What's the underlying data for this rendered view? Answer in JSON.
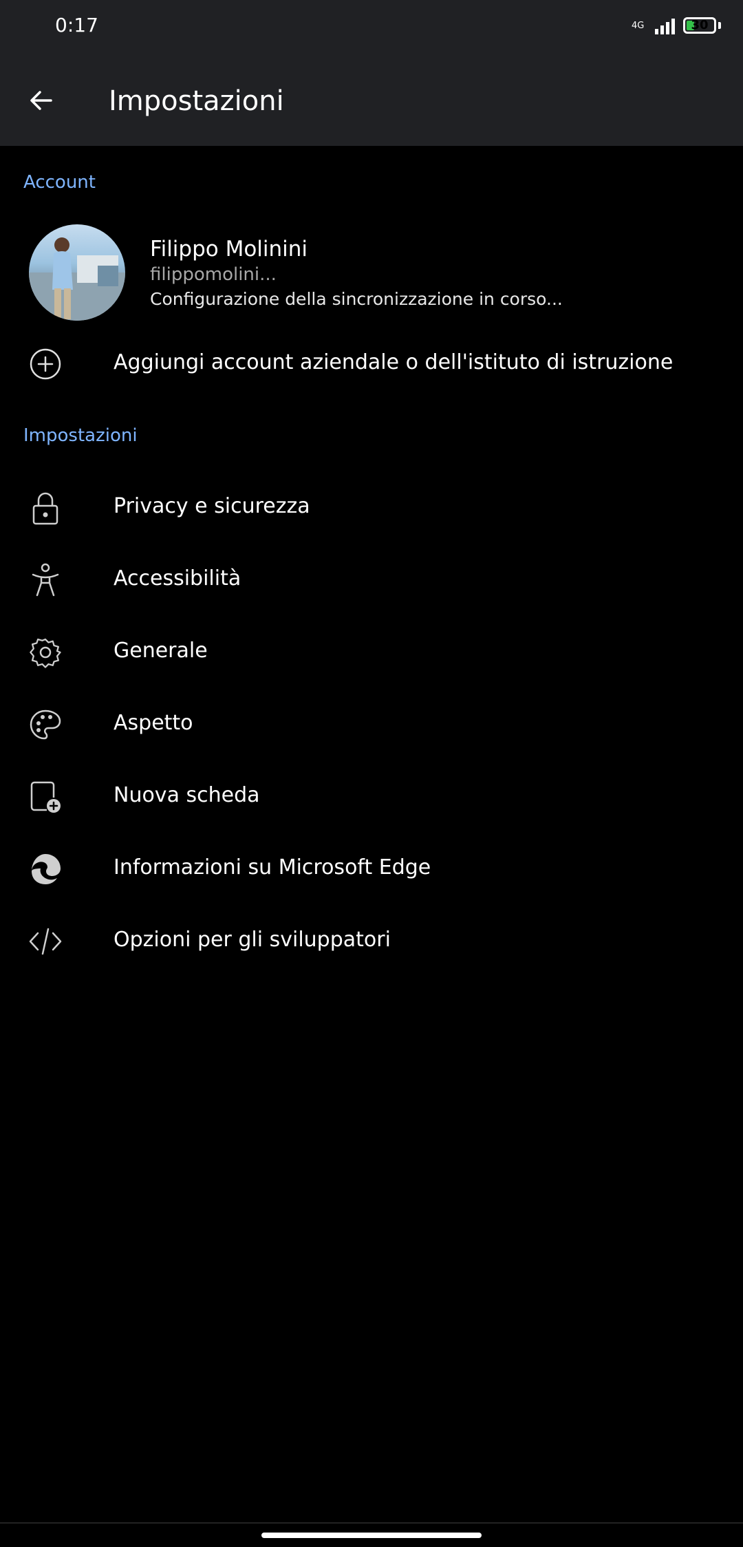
{
  "status_bar": {
    "time": "0:17",
    "network": "4G",
    "battery_level": "30",
    "battery_fraction": 0.3
  },
  "app_bar": {
    "back_icon": "arrow-left-icon",
    "title": "Impostazioni"
  },
  "account_section": {
    "label": "Account",
    "name": "Filippo Molinini",
    "email": "filippomolini...",
    "status": "Configurazione della sincronizzazione in corso...",
    "add_account": {
      "icon": "add-circle-icon",
      "label": "Aggiungi account aziendale o dell'istituto di istruzione"
    }
  },
  "settings_section": {
    "label": "Impostazioni",
    "items": [
      {
        "icon": "lock-icon",
        "label": "Privacy e sicurezza"
      },
      {
        "icon": "accessibility-icon",
        "label": "Accessibilità"
      },
      {
        "icon": "gear-icon",
        "label": "Generale"
      },
      {
        "icon": "palette-icon",
        "label": "Aspetto"
      },
      {
        "icon": "new-tab-icon",
        "label": "Nuova scheda"
      },
      {
        "icon": "edge-logo-icon",
        "label": "Informazioni su Microsoft Edge"
      },
      {
        "icon": "code-icon",
        "label": "Opzioni per gli sviluppatori"
      }
    ]
  },
  "colors": {
    "accent": "#7fb5ff",
    "appbar_bg": "#202124",
    "background": "#000000",
    "battery_fill": "#35c14a"
  }
}
